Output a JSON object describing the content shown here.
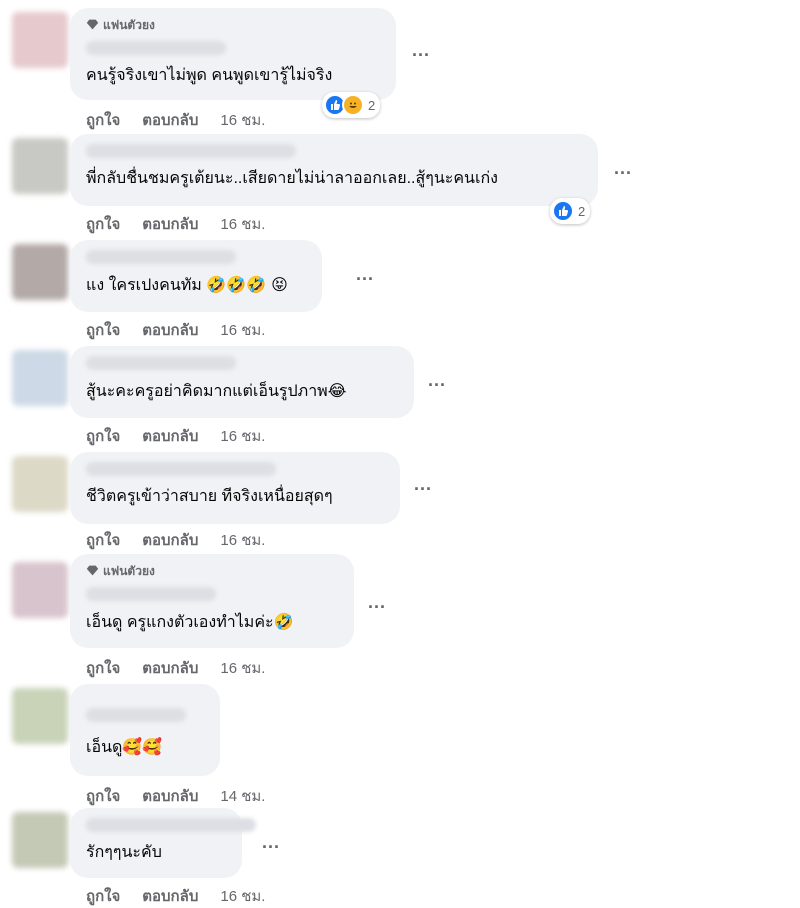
{
  "badge_label": "แฟนตัวยง",
  "actions": {
    "like": "ถูกใจ",
    "reply": "ตอบกลับ"
  },
  "comments": [
    {
      "badge": true,
      "text": "คนรู้จริงเขาไม่พูด คนพูดเขารู้ไม่จริง",
      "emoji": "",
      "time": "16 ชม.",
      "reactions": {
        "types": [
          "like",
          "haha"
        ],
        "count": "2"
      }
    },
    {
      "badge": false,
      "text": "พี่กลับชื่นชมครูเต้ยนะ..เสียดายไม่น่าลาออกเลย..สู้ๆนะคนเก่ง",
      "emoji": "",
      "time": "16 ชม.",
      "reactions": {
        "types": [
          "like"
        ],
        "count": "2"
      }
    },
    {
      "badge": false,
      "text": "แง ใครเปงคนทัม ",
      "emoji": "🤣🤣🤣 😝",
      "time": "16 ชม."
    },
    {
      "badge": false,
      "text": "สู้นะคะครูอย่าคิดมากแต่เอ็นรูปภาพ",
      "emoji": "😂",
      "time": "16 ชม."
    },
    {
      "badge": false,
      "text": "ชีวิตครูเข้าว่าสบาย ทีจริงเหนื่อยสุดๆ",
      "emoji": "",
      "time": "16 ชม."
    },
    {
      "badge": true,
      "text": "เอ็นดู ครูแกงตัวเองทำไมค่ะ",
      "emoji": "🤣",
      "time": "16 ชม."
    },
    {
      "badge": false,
      "text": "เอ็นดู",
      "emoji": "🥰🥰",
      "time": "14 ชม."
    },
    {
      "badge": false,
      "text": "รักๆๆนะคับ",
      "emoji": "",
      "time": "16 ชม."
    }
  ],
  "more_label": "...",
  "colors": {
    "bubble": "#f0f2f5",
    "secondary_text": "#65676b",
    "like_blue": "#1877f2",
    "haha_yellow": "#f7b125"
  }
}
